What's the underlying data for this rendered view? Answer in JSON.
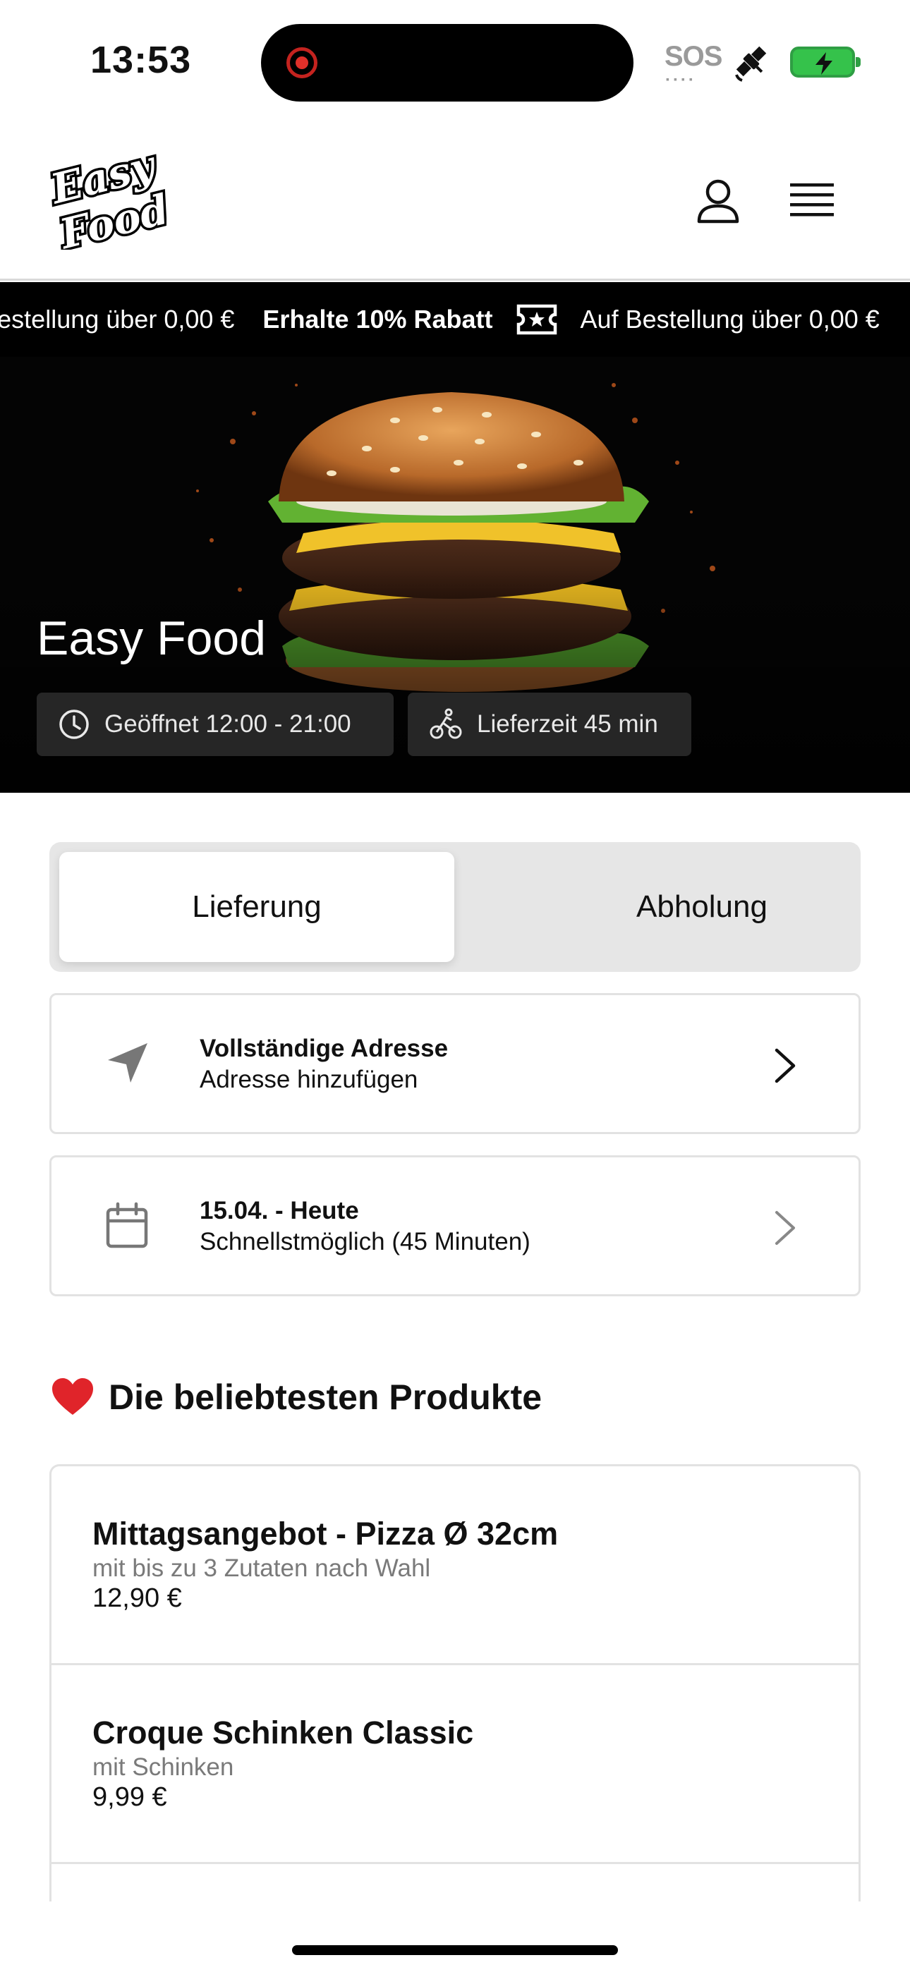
{
  "status_bar": {
    "time": "13:53",
    "sos": "SOS",
    "icons": [
      "screen-recording-icon",
      "satellite-icon",
      "battery-charging-icon"
    ]
  },
  "header": {
    "logo_line1": "Easy",
    "logo_line2": "Food",
    "icons": [
      "account-icon",
      "menu-icon"
    ]
  },
  "ticker": {
    "items": [
      {
        "text": "Erhalte 10% Rabatt",
        "bold": true
      },
      {
        "text": "Auf Bestellung über 0,00 €",
        "bold": false
      }
    ]
  },
  "hero": {
    "title": "Easy Food",
    "opening_hours": "Geöffnet 12:00 - 21:00",
    "delivery_time": "Lieferzeit 45 min"
  },
  "mode_toggle": {
    "delivery": "Lieferung",
    "pickup": "Abholung",
    "selected": "Lieferung"
  },
  "address_card": {
    "title": "Vollständige Adresse",
    "subtitle": "Adresse hinzufügen"
  },
  "schedule_card": {
    "title": "15.04. - Heute",
    "subtitle": "Schnellstmöglich (45 Minuten)"
  },
  "popular": {
    "title": "Die beliebtesten Produkte",
    "products": [
      {
        "name": "Mittagsangebot - Pizza Ø 32cm",
        "description": "mit bis zu 3 Zutaten nach Wahl",
        "price": "12,90 €"
      },
      {
        "name": "Croque Schinken Classic",
        "description": "mit Schinken",
        "price": "9,99 €"
      }
    ]
  },
  "colors": {
    "accent_dark": "#000000",
    "pill_bg": "#262626",
    "toggle_bg": "#e6e6e6",
    "border": "#e2e2e2",
    "heart": "#e0242a",
    "battery": "#35c24b"
  }
}
